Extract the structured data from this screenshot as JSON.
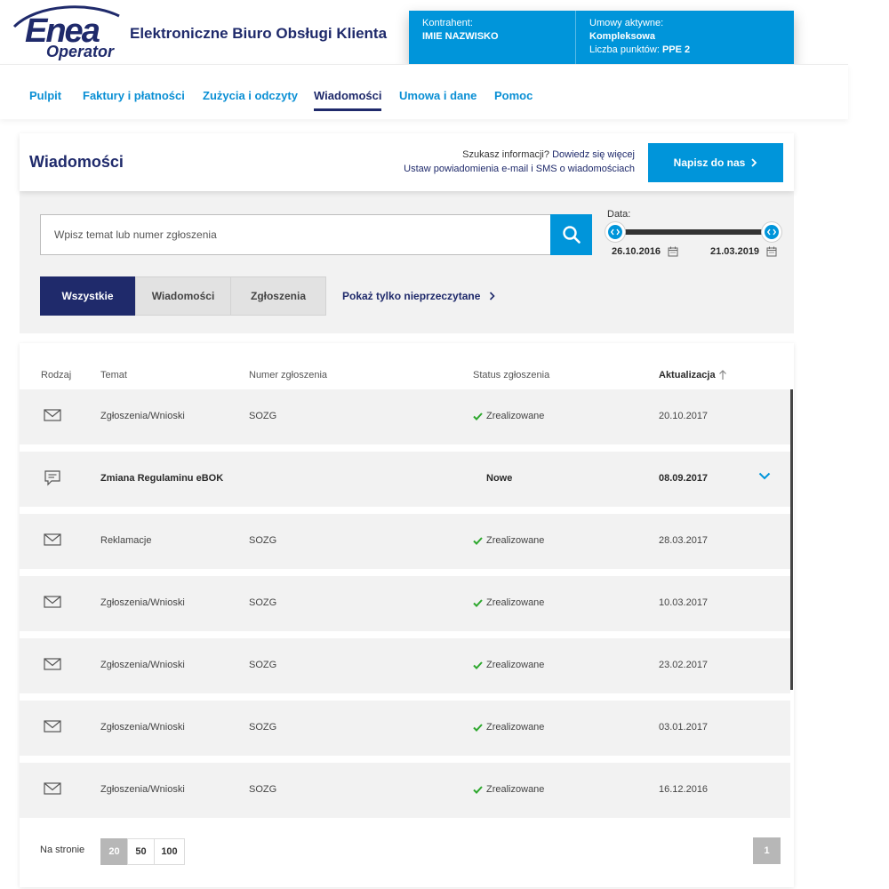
{
  "brand": {
    "logo_main": "Enea",
    "logo_sub": "Operator",
    "site_title": "Elektroniczne Biuro Obsługi Klienta",
    "accent": "#0095da",
    "navy": "#1f2a6b"
  },
  "account": {
    "contractor_label": "Kontrahent:",
    "contractor_name": "IMIE NAZWISKO",
    "contracts_label": "Umowy aktywne:",
    "contracts_value": "Kompleksowa",
    "points_label": "Liczba punktów:",
    "points_value": "PPE 2"
  },
  "nav": {
    "items": [
      "Pulpit",
      "Faktury i płatności",
      "Zużycia i odczyty",
      "Wiadomości",
      "Umowa i dane",
      "Pomoc"
    ],
    "active": "Wiadomości"
  },
  "page": {
    "title": "Wiadomości",
    "info_q": "Szukasz informacji?",
    "info_link": "Dowiedz się więcej",
    "notify_text": "Ustaw powiadomienia e-mail i SMS o wiadomościach",
    "write_button": "Napisz do nas"
  },
  "filters": {
    "search_placeholder": "Wpisz temat lub numer zgłoszenia",
    "date_label": "Data:",
    "date_from": "26.10.2016",
    "date_to": "21.03.2019",
    "segments": [
      "Wszystkie",
      "Wiadomości",
      "Zgłoszenia"
    ],
    "active_segment": "Wszystkie",
    "unread_link": "Pokaż tylko nieprzeczytane"
  },
  "table": {
    "headers": {
      "type": "Rodzaj",
      "subject": "Temat",
      "number": "Numer zgłoszenia",
      "status": "Status zgłoszenia",
      "updated": "Aktualizacja"
    },
    "rows": [
      {
        "icon": "envelope-icon",
        "subject": "Zgłoszenia/Wnioski",
        "number": "SOZG",
        "status": "Zrealizowane",
        "date": "20.10.2017",
        "unread": false
      },
      {
        "icon": "chat-icon",
        "subject": "Zmiana Regulaminu eBOK",
        "number": "",
        "status": "Nowe",
        "date": "08.09.2017",
        "unread": true
      },
      {
        "icon": "envelope-icon",
        "subject": "Reklamacje",
        "number": "SOZG",
        "status": "Zrealizowane",
        "date": "28.03.2017",
        "unread": false
      },
      {
        "icon": "envelope-icon",
        "subject": "Zgłoszenia/Wnioski",
        "number": "SOZG",
        "status": "Zrealizowane",
        "date": "10.03.2017",
        "unread": false
      },
      {
        "icon": "envelope-icon",
        "subject": "Zgłoszenia/Wnioski",
        "number": "SOZG",
        "status": "Zrealizowane",
        "date": "23.02.2017",
        "unread": false
      },
      {
        "icon": "envelope-icon",
        "subject": "Zgłoszenia/Wnioski",
        "number": "SOZG",
        "status": "Zrealizowane",
        "date": "03.01.2017",
        "unread": false
      },
      {
        "icon": "envelope-icon",
        "subject": "Zgłoszenia/Wnioski",
        "number": "SOZG",
        "status": "Zrealizowane",
        "date": "16.12.2016",
        "unread": false
      }
    ]
  },
  "pagination": {
    "per_page_label": "Na stronie",
    "per_page_options": [
      "20",
      "50",
      "100"
    ],
    "active_per_page": "20",
    "current_page": "1"
  }
}
